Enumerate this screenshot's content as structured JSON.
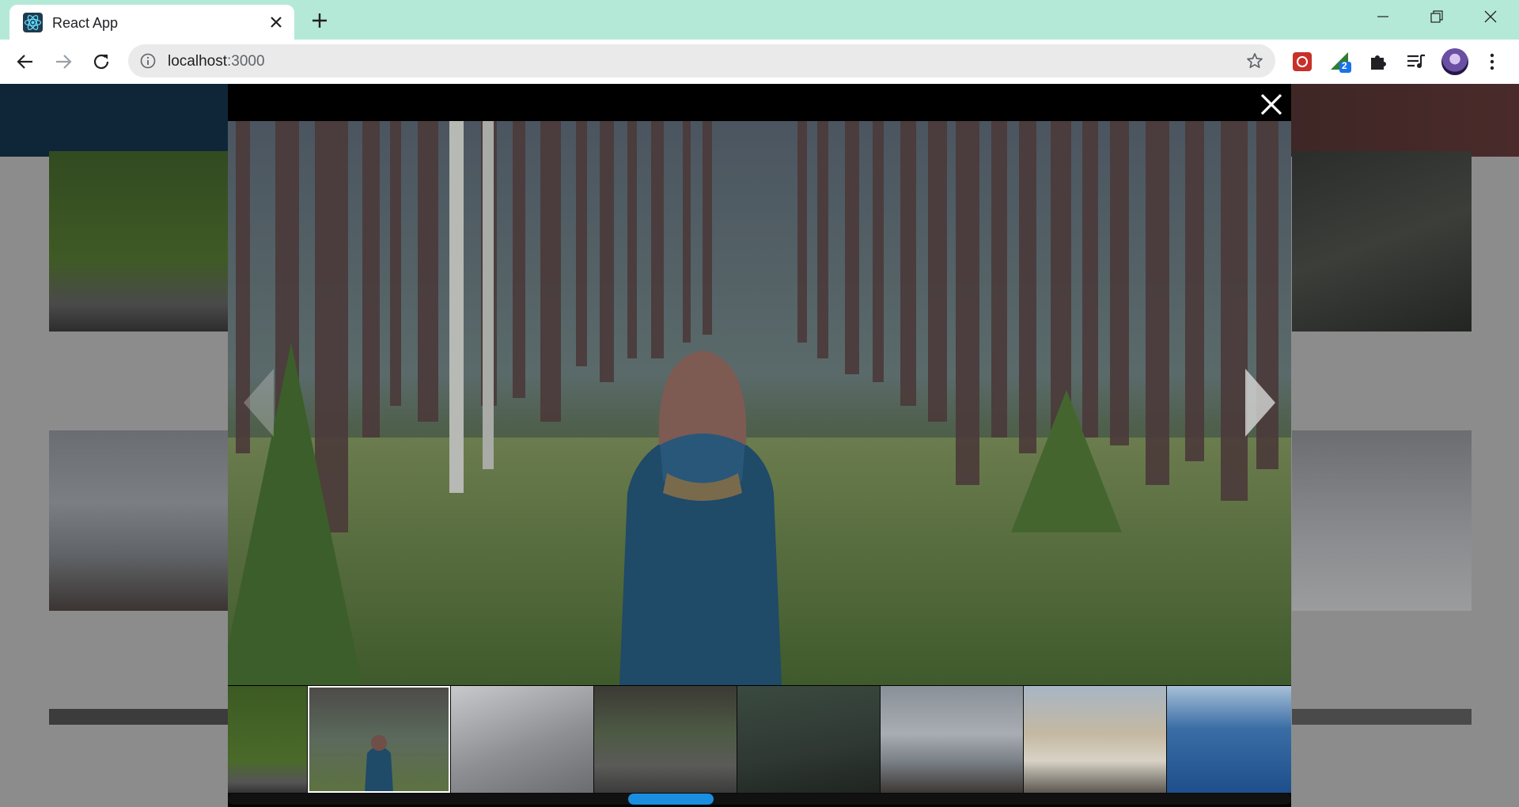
{
  "browser": {
    "tab_title": "React App",
    "url_host": "localhost",
    "url_port": ":3000",
    "extension_badge": "2"
  },
  "gallery": {
    "background_images": [
      "green field with road",
      "dark playground swings",
      "misty lake shore",
      "snowy field with person",
      "dark image",
      "dark image"
    ],
    "active_image": "woman in blue hood in pine forest",
    "thumbnails": [
      {
        "name": "green-field-thumb",
        "active": false
      },
      {
        "name": "forest-woman-thumb",
        "active": true
      },
      {
        "name": "frosty-plants-thumb",
        "active": false
      },
      {
        "name": "forest-road-thumb",
        "active": false
      },
      {
        "name": "swings-thumb",
        "active": false
      },
      {
        "name": "misty-lake-thumb",
        "active": false
      },
      {
        "name": "golden-gate-beach-thumb",
        "active": false
      },
      {
        "name": "blue-bay-city-thumb",
        "active": false
      }
    ],
    "scroll_position": 0.41
  },
  "colors": {
    "tabstrip": "#b5e9d7",
    "scroll_thumb": "#1a8fe0",
    "overlay": "#000000"
  }
}
